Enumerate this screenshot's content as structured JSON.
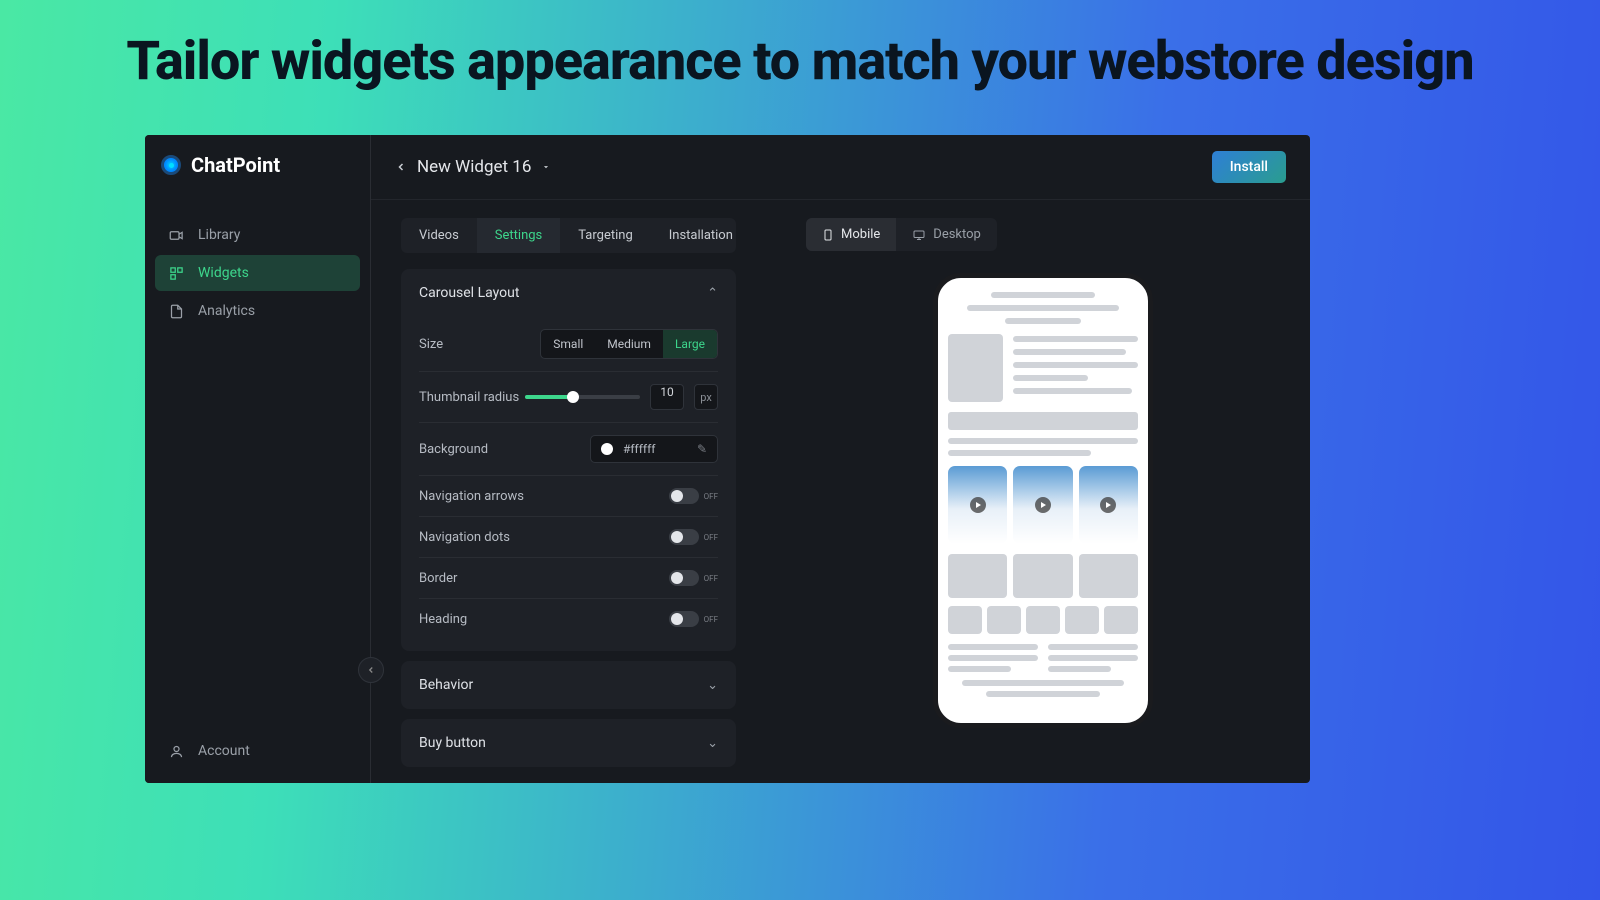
{
  "page": {
    "headline": "Tailor widgets appearance to match your webstore design"
  },
  "brand": "ChatPoint",
  "sidebar": {
    "items": [
      {
        "label": "Library",
        "icon": "camera-icon"
      },
      {
        "label": "Widgets",
        "icon": "widgets-icon"
      },
      {
        "label": "Analytics",
        "icon": "document-icon"
      }
    ],
    "account": "Account"
  },
  "header": {
    "title": "New Widget 16",
    "install": "Install"
  },
  "tabs": [
    "Videos",
    "Settings",
    "Targeting",
    "Installation"
  ],
  "active_tab": "Settings",
  "panel": {
    "title": "Carousel Layout",
    "size": {
      "label": "Size",
      "options": [
        "Small",
        "Medium",
        "Large"
      ],
      "active": "Large"
    },
    "radius": {
      "label": "Thumbnail radius",
      "value": "10",
      "unit": "px"
    },
    "background": {
      "label": "Background",
      "value": "#ffffff"
    },
    "toggles": [
      {
        "label": "Navigation arrows",
        "state": "Off"
      },
      {
        "label": "Navigation dots",
        "state": "Off"
      },
      {
        "label": "Border",
        "state": "Off"
      },
      {
        "label": "Heading",
        "state": "Off"
      }
    ]
  },
  "collapsed_panels": [
    "Behavior",
    "Buy button"
  ],
  "device_tabs": [
    "Mobile",
    "Desktop"
  ],
  "active_device": "Mobile"
}
